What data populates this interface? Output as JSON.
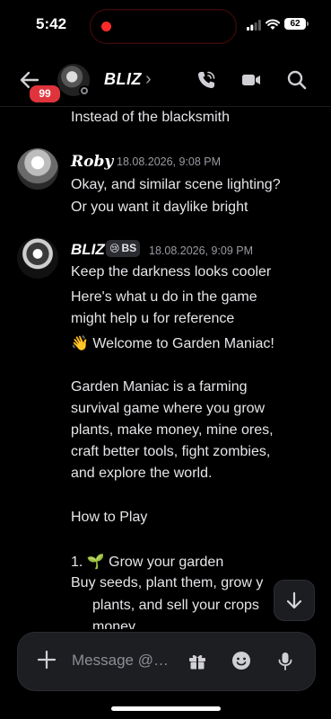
{
  "status_bar": {
    "time": "5:42",
    "battery": "62"
  },
  "header": {
    "unread_badge": "99",
    "channel_name": "BLIZ",
    "chevron": "›"
  },
  "messages": {
    "continued_line": "Instead of the blacksmith",
    "roby": {
      "username": "Roby",
      "timestamp": "18.08.2026, 9:08 PM",
      "lines": [
        "Okay, and similar scene lighting?",
        "Or you want it daylike bright"
      ]
    },
    "bliz": {
      "username": "BLIZ",
      "tag_emoji": "😢",
      "tag_text": "BS",
      "timestamp": "18.08.2026, 9:09 PM",
      "lines": [
        "Keep the darkness looks cooler",
        "Here's what u do in the game",
        "might help u for reference",
        "👋 Welcome to Garden Maniac!",
        "",
        "Garden Maniac is a farming",
        "survival game where you grow",
        "plants, make money, mine ores,",
        "craft better tools, fight zombies,",
        "and explore the world.",
        "",
        "How to Play",
        "",
        "1.  🌱 Grow your garden",
        "Buy seeds, plant them, grow y",
        "plants, and sell your crops",
        "money"
      ]
    }
  },
  "composer": {
    "placeholder": "Message @…"
  },
  "colors": {
    "background": "#000000",
    "badge": "#e0343d",
    "composer": "#1d1e22"
  }
}
